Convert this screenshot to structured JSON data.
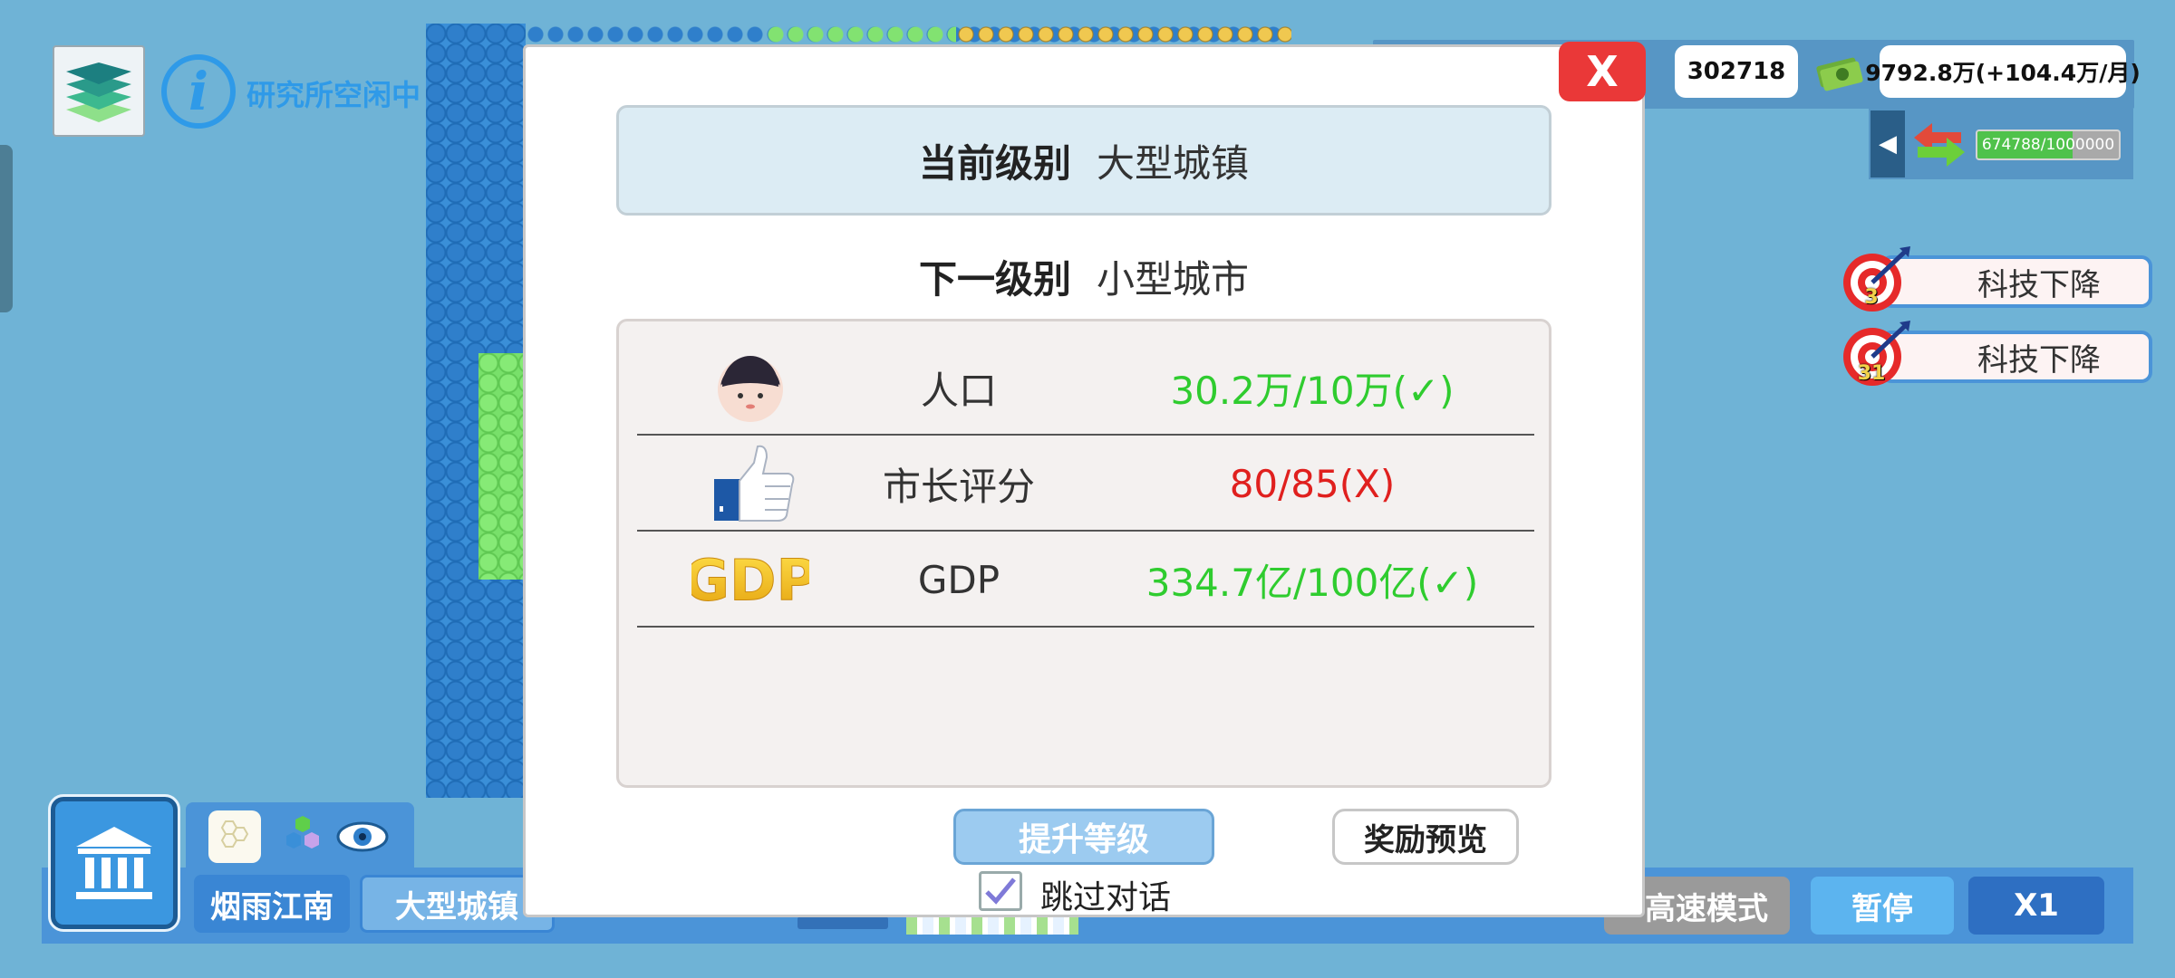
{
  "hud": {
    "research_status": "研究所空闲中",
    "population_total": "302718",
    "money": "9792.8万(+104.4万/月)",
    "trade_progress_text": "674788/1000000",
    "trade_progress_fraction": 0.67,
    "quests": [
      {
        "label": "科技下降",
        "count": "3"
      },
      {
        "label": "科技下降",
        "count": "31"
      }
    ]
  },
  "bottom_bar": {
    "region_name": "烟雨江南",
    "city_level": "大型城镇",
    "high_speed_mode": "高速模式",
    "pause": "暂停",
    "speed": "X1"
  },
  "modal": {
    "close_label": "X",
    "current_level_label": "当前级别",
    "current_level_value": "大型城镇",
    "next_level_label": "下一级别",
    "next_level_value": "小型城市",
    "requirements": [
      {
        "icon": "person-icon",
        "name": "人口",
        "value": "30.2万/10万(✓)",
        "status": "ok"
      },
      {
        "icon": "thumbs-up-icon",
        "name": "市长评分",
        "value": "80/85(X)",
        "status": "bad"
      },
      {
        "icon": "gdp-icon",
        "name": "GDP",
        "value": "334.7亿/100亿(✓)",
        "status": "ok"
      }
    ],
    "upgrade_button": "提升等级",
    "reward_preview_button": "奖励预览",
    "skip_dialog_label": "跳过对话",
    "skip_dialog_checked": true
  },
  "colors": {
    "background": "#6fb3d6",
    "accent_blue": "#4b94d8",
    "ok_green": "#2fcc2f",
    "fail_red": "#e0201e",
    "close_red": "#ea3838"
  }
}
